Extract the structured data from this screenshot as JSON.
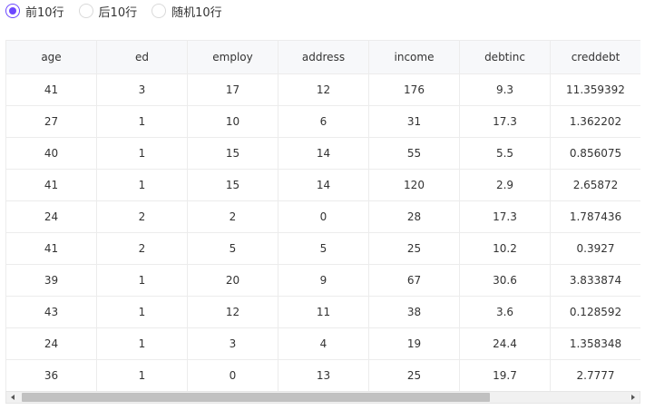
{
  "radio_options": [
    {
      "label": "前10行",
      "checked": true
    },
    {
      "label": "后10行",
      "checked": false
    },
    {
      "label": "随机10行",
      "checked": false
    }
  ],
  "colors": {
    "accent": "#6c47ff"
  },
  "table": {
    "columns": [
      "age",
      "ed",
      "employ",
      "address",
      "income",
      "debtinc",
      "creddebt",
      ""
    ],
    "rows": [
      [
        "41",
        "3",
        "17",
        "12",
        "176",
        "9.3",
        "11.359392",
        ""
      ],
      [
        "27",
        "1",
        "10",
        "6",
        "31",
        "17.3",
        "1.362202",
        ""
      ],
      [
        "40",
        "1",
        "15",
        "14",
        "55",
        "5.5",
        "0.856075",
        ""
      ],
      [
        "41",
        "1",
        "15",
        "14",
        "120",
        "2.9",
        "2.65872",
        ""
      ],
      [
        "24",
        "2",
        "2",
        "0",
        "28",
        "17.3",
        "1.787436",
        ""
      ],
      [
        "41",
        "2",
        "5",
        "5",
        "25",
        "10.2",
        "0.3927",
        ""
      ],
      [
        "39",
        "1",
        "20",
        "9",
        "67",
        "30.6",
        "3.833874",
        ""
      ],
      [
        "43",
        "1",
        "12",
        "11",
        "38",
        "3.6",
        "0.128592",
        ""
      ],
      [
        "24",
        "1",
        "3",
        "4",
        "19",
        "24.4",
        "1.358348",
        ""
      ],
      [
        "36",
        "1",
        "0",
        "13",
        "25",
        "19.7",
        "2.7777",
        ""
      ]
    ]
  },
  "scrollbar": {
    "left_icon": "chevron-left-icon",
    "right_icon": "chevron-right-icon"
  }
}
